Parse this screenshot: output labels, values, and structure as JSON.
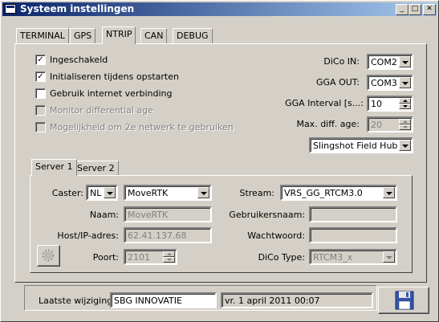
{
  "window": {
    "title": "Systeem instellingen",
    "controls": [
      "minimize",
      "maximize",
      "close"
    ]
  },
  "tabs": [
    {
      "label": "TERMINAL",
      "active": false
    },
    {
      "label": "GPS",
      "active": false
    },
    {
      "label": "NTRIP",
      "active": true
    },
    {
      "label": "CAN",
      "active": false
    },
    {
      "label": "DEBUG",
      "active": false
    }
  ],
  "ntrip": {
    "checkboxes": [
      {
        "label": "Ingeschakeld",
        "checked": true,
        "enabled": true
      },
      {
        "label": "Initialiseren tijdens opstarten",
        "checked": true,
        "enabled": true
      },
      {
        "label": "Gebruik internet verbinding",
        "checked": false,
        "enabled": true
      },
      {
        "label": "Monitor differential age",
        "checked": false,
        "enabled": false
      },
      {
        "label": "Mogelijkheid om 2e netwerk te gebruiken",
        "checked": false,
        "enabled": false
      }
    ],
    "dico_in": {
      "label": "DiCo IN:",
      "value": "COM2"
    },
    "gga_out": {
      "label": "GGA OUT:",
      "value": "COM3"
    },
    "gga_interval": {
      "label": "GGA Interval [s...:",
      "value": "10"
    },
    "max_diff_age": {
      "label": "Max. diff. age:",
      "value": "20"
    },
    "hub": {
      "value": "Slingshot Field Hub"
    }
  },
  "server_tabs": [
    {
      "label": "Server 1",
      "active": true
    },
    {
      "label": "Server 2",
      "active": false
    }
  ],
  "server": {
    "caster_label": "Caster:",
    "caster_country": "NL",
    "caster_name": "MoveRTK",
    "naam_label": "Naam:",
    "naam_value": "MoveRTK",
    "host_label": "Host/IP-adres:",
    "host_value": "62.41.137.68",
    "poort_label": "Poort:",
    "poort_value": "2101",
    "stream_label": "Stream:",
    "stream_value": "VRS_GG_RTCM3.0",
    "user_label": "Gebruikersnaam:",
    "user_value": "",
    "pass_label": "Wachtwoord:",
    "pass_value": "",
    "dico_type_label": "DiCo Type:",
    "dico_type_value": "RTCM3_x"
  },
  "footer": {
    "last_change_label": "Laatste wijziging:",
    "last_change_user": "SBG INNOVATIE",
    "last_change_version": "vr. 1 april 2011 00:07"
  },
  "icons": {
    "title": "window-app-icon",
    "save": "floppy-disk-icon",
    "settings": "gear-icon"
  }
}
